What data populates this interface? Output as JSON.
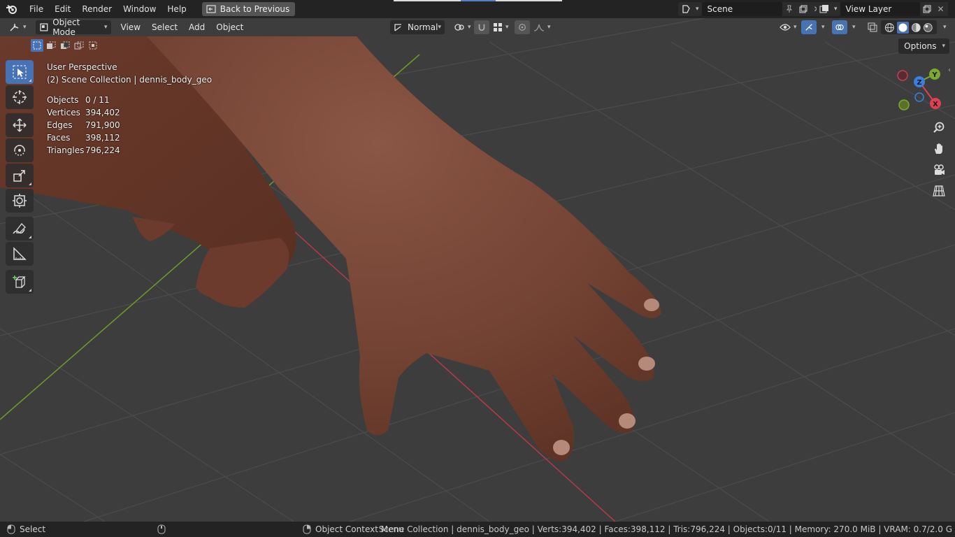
{
  "topbar": {
    "menus": [
      "File",
      "Edit",
      "Render",
      "Window",
      "Help"
    ],
    "back_button": "Back to Previous",
    "scene_name": "Scene",
    "view_layer": "View Layer"
  },
  "viewport_header": {
    "mode": "Object Mode",
    "menus": [
      "View",
      "Select",
      "Add",
      "Object"
    ],
    "orientation": "Normal",
    "options_label": "Options"
  },
  "overlay": {
    "perspective": "User Perspective",
    "collection": "(2) Scene Collection | dennis_body_geo",
    "stats": [
      {
        "label": "Objects",
        "value": "0 / 11"
      },
      {
        "label": "Vertices",
        "value": "394,402"
      },
      {
        "label": "Edges",
        "value": "791,900"
      },
      {
        "label": "Faces",
        "value": "398,112"
      },
      {
        "label": "Triangles",
        "value": "796,224"
      }
    ]
  },
  "gizmo": {
    "x": "X",
    "y": "Y",
    "z": "Z"
  },
  "statusbar": {
    "left_action": "Select",
    "middle_action": "Object Context Menu",
    "info": "Scene Collection | dennis_body_geo | Verts:394,402 | Faces:398,112 | Tris:796,224 | Objects:0/11 | Memory: 270.0 MiB | VRAM: 0.7/2.0 G"
  },
  "colors": {
    "accent": "#4772b3",
    "skin": "#7a4535",
    "axis_x": "#e04050",
    "axis_y": "#7aaa30",
    "axis_z": "#3a80e0"
  },
  "icons": {
    "tools": [
      "select-box-icon",
      "cursor-icon",
      "move-icon",
      "rotate-icon",
      "scale-icon",
      "transform-icon",
      "annotate-icon",
      "measure-icon",
      "add-cube-icon"
    ],
    "nav": [
      "zoom-icon",
      "pan-hand-icon",
      "camera-icon",
      "grid-view-icon"
    ]
  }
}
